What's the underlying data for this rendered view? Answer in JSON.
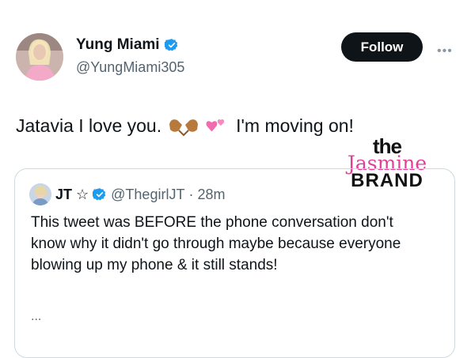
{
  "author": {
    "display_name": "Yung Miami",
    "handle": "@YungMiami305",
    "verified": true
  },
  "follow_label": "Follow",
  "more_icon": "ellipsis-icon",
  "tweet": {
    "text_before": "Jatavia I love you.",
    "emoji": [
      "heart-hands-icon",
      "two-hearts-icon"
    ],
    "text_after": "I'm moving on!"
  },
  "watermark": {
    "line1": "the",
    "line2": "Jasmine",
    "line3": "BRAND"
  },
  "quote": {
    "name": "JT",
    "name_symbol": "☆",
    "handle": "@ThegirlJT",
    "time": "· 28m",
    "text": "This tweet was BEFORE the phone conversation don't know why it didn't go through maybe because everyone blowing up my phone & it still stands!",
    "ellipsis": "..."
  },
  "colors": {
    "verified_blue": "#1d9bf0",
    "follow_bg": "#0f1419",
    "watermark_pink": "#e33f9a",
    "secondary_text": "#536471"
  }
}
